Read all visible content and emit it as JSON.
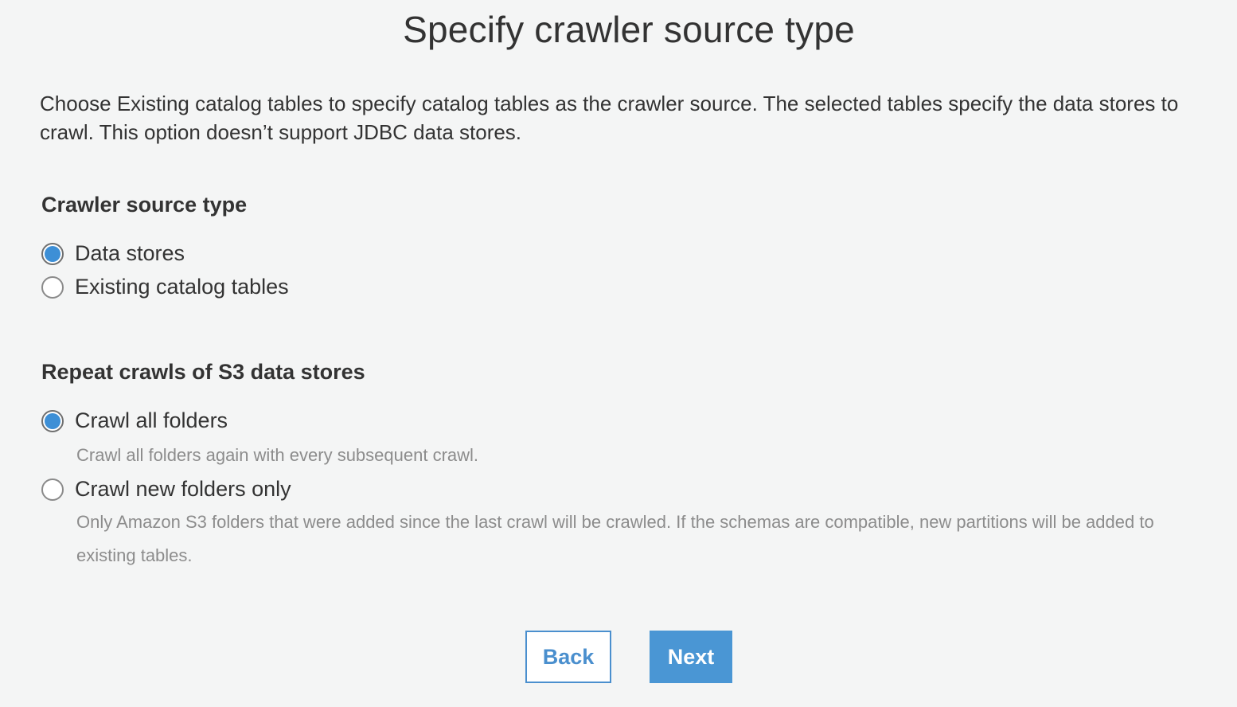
{
  "page_title": "Specify crawler source type",
  "description": "Choose Existing catalog tables to specify catalog tables as the crawler source. The selected tables specify the data stores to crawl. This option doesn’t support JDBC data stores.",
  "source_type": {
    "heading": "Crawler source type",
    "options": [
      {
        "label": "Data stores",
        "selected": true
      },
      {
        "label": "Existing catalog tables",
        "selected": false
      }
    ]
  },
  "repeat_crawls": {
    "heading": "Repeat crawls of S3 data stores",
    "options": [
      {
        "label": "Crawl all folders",
        "help": "Crawl all folders again with every subsequent crawl.",
        "selected": true
      },
      {
        "label": "Crawl new folders only",
        "help": "Only Amazon S3 folders that were added since the last crawl will be crawled. If the schemas are compatible, new partitions will be added to existing tables.",
        "selected": false
      }
    ]
  },
  "buttons": {
    "back": "Back",
    "next": "Next"
  },
  "colors": {
    "accent": "#4a96d4",
    "background": "#f4f5f5",
    "help_text": "#8c8c8c"
  }
}
